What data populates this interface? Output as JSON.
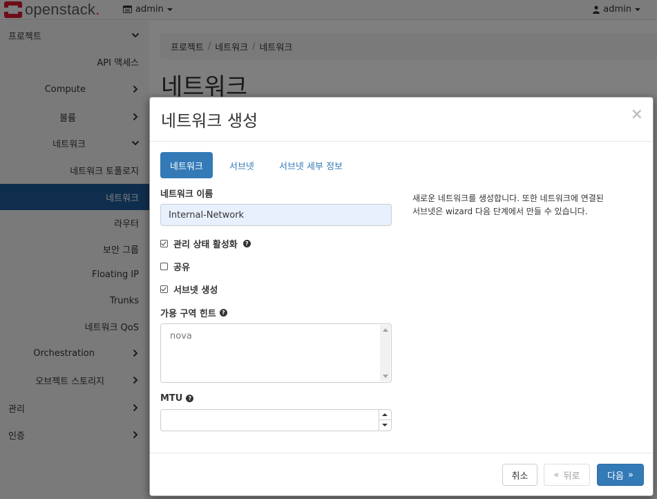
{
  "navbar": {
    "logo_text": "openstack",
    "logo_dot": ".",
    "project_menu": "admin",
    "user_menu": "admin"
  },
  "sidebar": {
    "items": [
      {
        "label": "프로젝트",
        "chevron": "down"
      },
      {
        "label": "API 액세스"
      },
      {
        "label": "Compute",
        "chevron": "right"
      },
      {
        "label": "볼륨",
        "chevron": "right"
      },
      {
        "label": "네트워크",
        "chevron": "down"
      },
      {
        "label": "네트워크 토폴로지"
      },
      {
        "label": "네트워크",
        "active": true
      },
      {
        "label": "라우터"
      },
      {
        "label": "보안 그룹"
      },
      {
        "label": "Floating IP"
      },
      {
        "label": "Trunks"
      },
      {
        "label": "네트워크 QoS"
      },
      {
        "label": "Orchestration",
        "chevron": "right"
      },
      {
        "label": "오브젝트 스토리지",
        "chevron": "right"
      },
      {
        "label": "관리",
        "chevron": "right"
      },
      {
        "label": "인증",
        "chevron": "right"
      }
    ]
  },
  "breadcrumb": [
    "프로젝트",
    "네트워크",
    "네트워크"
  ],
  "breadcrumb_sep": "/",
  "page_title": "네트워크",
  "modal": {
    "title": "네트워크 생성",
    "close": "×",
    "tabs": [
      "네트워크",
      "서브넷",
      "서브넷 세부 정보"
    ],
    "network_name_label": "네트워크 이름",
    "network_name_value": "Internal-Network",
    "admin_state_label": "관리 상태 활성화",
    "admin_state_checked": true,
    "shared_label": "공유",
    "shared_checked": false,
    "create_subnet_label": "서브넷 생성",
    "create_subnet_checked": true,
    "az_hints_label": "가용 구역 힌트",
    "az_hints_value": "nova",
    "mtu_label": "MTU",
    "mtu_value": "",
    "help_text_line1": "새로운 네트워크를 생성합니다. 또한 네트워크에 연결된",
    "help_text_line2": "서브넷은 wizard 다음 단계에서 만들 수 있습니다.",
    "buttons": {
      "cancel": "취소",
      "back": "뒤로",
      "next": "다음",
      "back_icon": "«",
      "next_icon": "»"
    },
    "help_icon": "?"
  },
  "colors": {
    "primary": "#337ab7",
    "sidebar_active": "#1f5d9c",
    "brand_red": "#da1a32"
  }
}
